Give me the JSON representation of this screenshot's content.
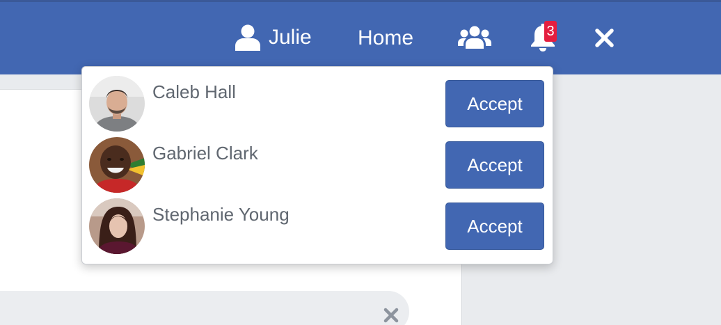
{
  "navbar": {
    "user_name": "Julie",
    "home_label": "Home",
    "notification_count": "3",
    "icons": {
      "user": "user-icon",
      "friends": "friends-icon",
      "notifications": "bell-icon",
      "close": "close-icon"
    },
    "colors": {
      "bar": "#4267b2",
      "badge": "#e41e3f"
    }
  },
  "friend_requests": [
    {
      "name": "Caleb Hall",
      "action_label": "Accept"
    },
    {
      "name": "Gabriel Clark",
      "action_label": "Accept"
    },
    {
      "name": "Stephanie Young",
      "action_label": "Accept"
    }
  ],
  "colors": {
    "accent": "#4267b2",
    "page_bg": "#e9ebee",
    "text": "#606770"
  }
}
